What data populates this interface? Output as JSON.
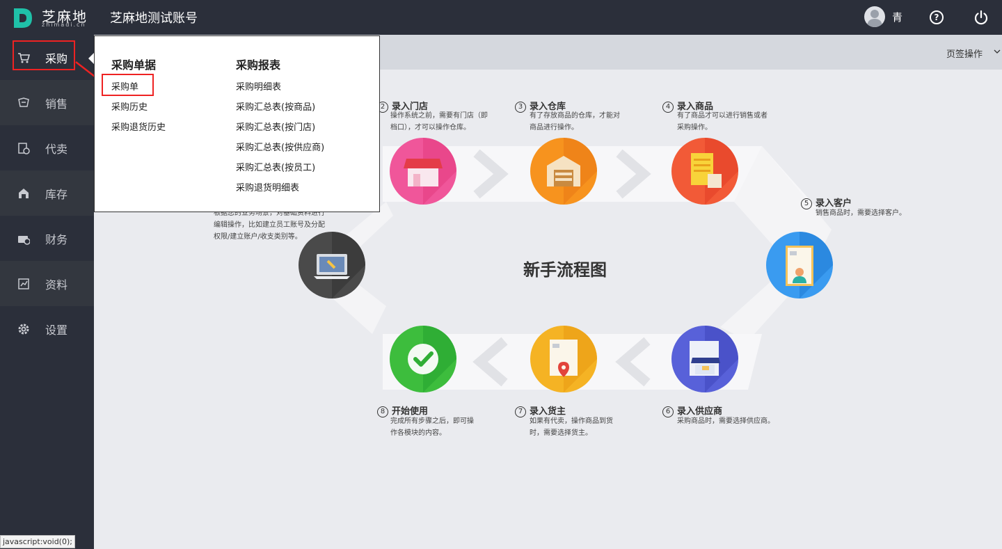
{
  "header": {
    "logo_text": "芝麻地",
    "logo_sub": "zhimadi.cn",
    "account_title": "芝麻地测试账号",
    "user_name": "青",
    "help_icon": "help-icon",
    "power_icon": "power-icon"
  },
  "sidebar": {
    "items": [
      {
        "label": "采购",
        "icon": "cart-icon",
        "active": true
      },
      {
        "label": "销售",
        "icon": "sale-icon"
      },
      {
        "label": "代卖",
        "icon": "consign-icon"
      },
      {
        "label": "库存",
        "icon": "warehouse-icon"
      },
      {
        "label": "财务",
        "icon": "finance-icon"
      },
      {
        "label": "资料",
        "icon": "data-icon"
      },
      {
        "label": "设置",
        "icon": "gear-icon"
      }
    ]
  },
  "tabs": {
    "ops_label": "页签操作"
  },
  "dropdown": {
    "col1_title": "采购单据",
    "col1_links": [
      "采购单",
      "采购历史",
      "采购退货历史"
    ],
    "col2_title": "采购报表",
    "col2_links": [
      "采购明细表",
      "采购汇总表(按商品)",
      "采购汇总表(按门店)",
      "采购汇总表(按供应商)",
      "采购汇总表(按员工)",
      "采购退货明细表"
    ]
  },
  "flow": {
    "center_title": "新手流程图",
    "steps": [
      {
        "num": "②",
        "title": "录入门店",
        "desc": [
          "操作系统之前，需要有门店（即",
          "档口），才可以操作仓库。"
        ],
        "color": "#f0569a"
      },
      {
        "num": "3",
        "title": "录入仓库",
        "desc": [
          "有了存放商品的仓库，才能对",
          "商品进行操作。"
        ],
        "color": "#f7931e"
      },
      {
        "num": "4",
        "title": "录入商品",
        "desc": [
          "有了商品才可以进行销售或者",
          "采购操作。"
        ],
        "color": "#f25a37"
      },
      {
        "num": "5",
        "title": "录入客户",
        "desc": [
          "销售商品时，需要选择客户。"
        ],
        "color": "#3a9bf0"
      },
      {
        "num": "6",
        "title": "录入供应商",
        "desc": [
          "采购商品时，需要选择供应商。"
        ],
        "color": "#5861d9"
      },
      {
        "num": "7",
        "title": "录入货主",
        "desc": [
          "如果有代卖，操作商品到货",
          "时，需要选择货主。"
        ],
        "color": "#f5b324"
      },
      {
        "num": "8",
        "title": "开始使用",
        "desc": [
          "完成所有步骤之后，即可操",
          "作各模块的内容。"
        ],
        "color": "#3dbd3d"
      }
    ],
    "step1_partial": [
      "根据您的业务场景，对基础资料进行",
      "编辑操作，比如建立员工账号及分配",
      "权限/建立账户/收支类别等。"
    ]
  },
  "status_bar": "javascript:void(0);"
}
